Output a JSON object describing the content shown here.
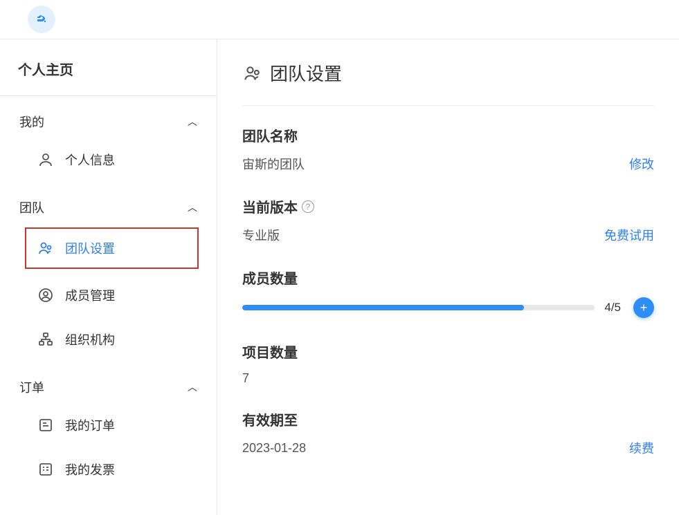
{
  "colors": {
    "accent": "#2d8ef8",
    "highlight_border": "#c0392b"
  },
  "sidebar": {
    "title": "个人主页",
    "sections": [
      {
        "label": "我的",
        "items": [
          {
            "label": "个人信息",
            "icon": "user-icon",
            "active": false
          }
        ]
      },
      {
        "label": "团队",
        "items": [
          {
            "label": "团队设置",
            "icon": "team-icon",
            "active": true
          },
          {
            "label": "成员管理",
            "icon": "member-icon",
            "active": false
          },
          {
            "label": "组织机构",
            "icon": "org-icon",
            "active": false
          }
        ]
      },
      {
        "label": "订单",
        "items": [
          {
            "label": "我的订单",
            "icon": "order-icon",
            "active": false
          },
          {
            "label": "我的发票",
            "icon": "invoice-icon",
            "active": false
          }
        ]
      }
    ]
  },
  "main": {
    "title": "团队设置",
    "team_name": {
      "label": "团队名称",
      "value": "宙斯的团队",
      "action": "修改"
    },
    "version": {
      "label": "当前版本",
      "value": "专业版",
      "action": "免费试用"
    },
    "members": {
      "label": "成员数量",
      "used": 4,
      "total": 5,
      "text": "4/5",
      "percent": 80,
      "add_icon": "plus-icon"
    },
    "projects": {
      "label": "项目数量",
      "value": "7"
    },
    "expiry": {
      "label": "有效期至",
      "value": "2023-01-28",
      "action": "续费"
    }
  }
}
